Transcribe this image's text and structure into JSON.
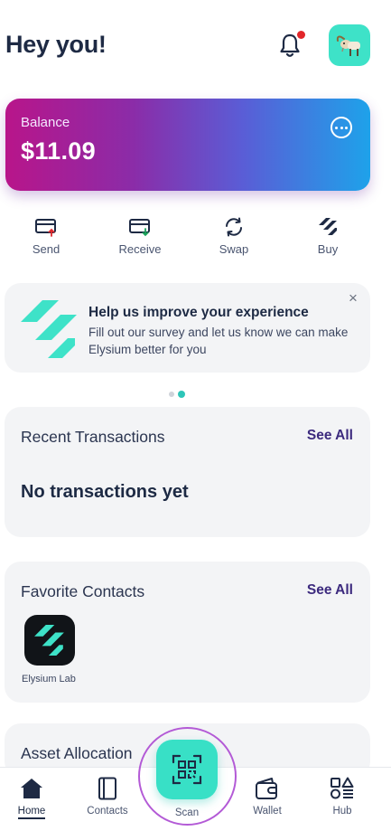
{
  "header": {
    "greeting": "Hey you!",
    "has_notification": true
  },
  "balance": {
    "label": "Balance",
    "value": "$11.09",
    "gradient_colors": [
      "#b8158a",
      "#1ea2ea"
    ]
  },
  "actions": [
    {
      "label": "Send",
      "icon": "card-send-icon"
    },
    {
      "label": "Receive",
      "icon": "card-receive-icon"
    },
    {
      "label": "Swap",
      "icon": "swap-icon"
    },
    {
      "label": "Buy",
      "icon": "buy-icon"
    }
  ],
  "survey": {
    "title": "Help us improve your experience",
    "text": "Fill out our survey and let us know we can make Elysium better for you"
  },
  "carousel": {
    "count": 2,
    "active_index": 1
  },
  "transactions": {
    "title": "Recent Transactions",
    "see_all": "See All",
    "empty": "No transactions yet"
  },
  "contacts": {
    "title": "Favorite Contacts",
    "see_all": "See All",
    "items": [
      {
        "name": "Elysium Lab"
      }
    ]
  },
  "allocation": {
    "title": "Asset Allocation"
  },
  "nav": {
    "home": "Home",
    "contacts": "Contacts",
    "scan": "Scan",
    "wallet": "Wallet",
    "hub": "Hub"
  },
  "colors": {
    "accent_teal": "#38e0c6",
    "see_all": "#3c2a7e",
    "scan_ring": "#b35ad6"
  }
}
